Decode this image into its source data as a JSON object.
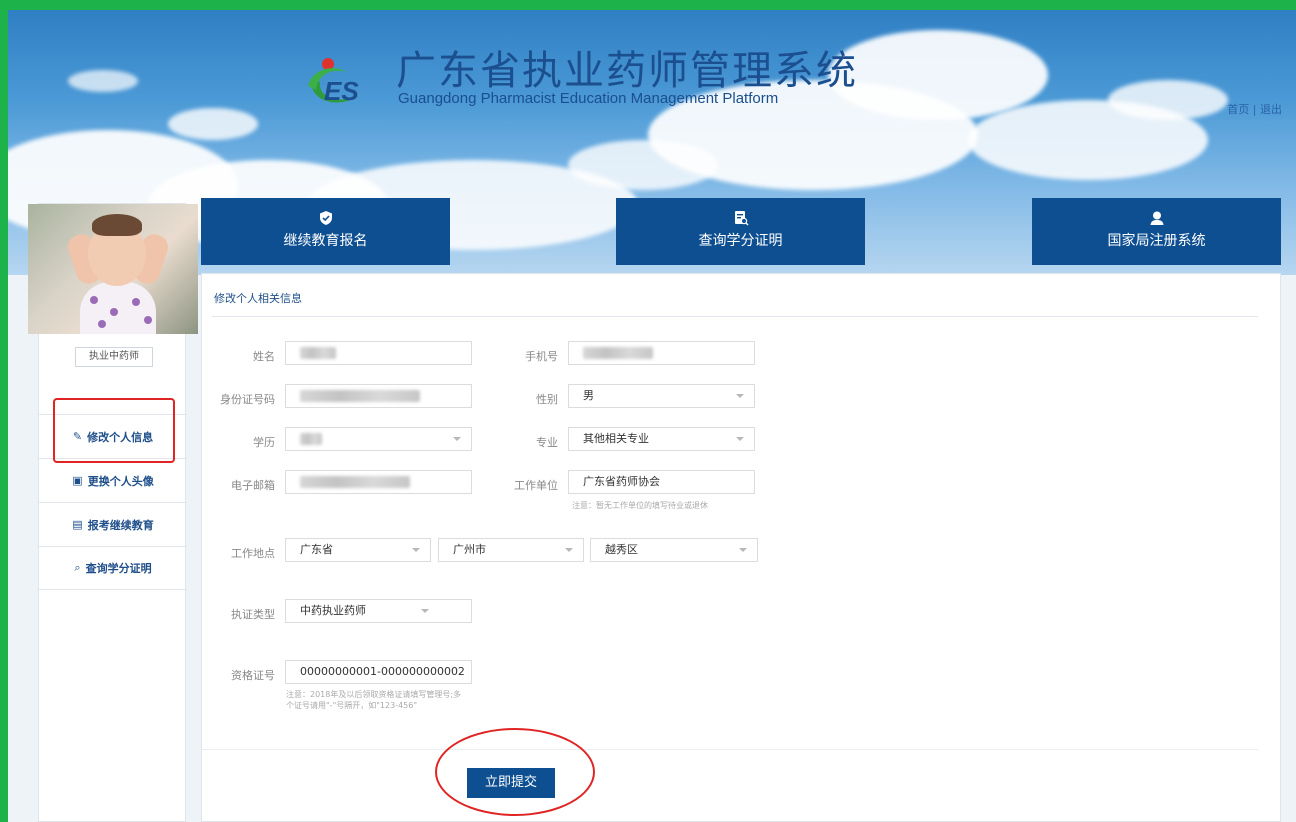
{
  "header": {
    "logo_text": "ES",
    "title": "广东省执业药师管理系统",
    "subtitle": "Guangdong Pharmacist Education Management Platform",
    "home_link": "首页",
    "separator": "|",
    "logout_link": "退出"
  },
  "nav": [
    {
      "label": "继续教育报名",
      "icon": "shield-icon"
    },
    {
      "label": "查询学分证明",
      "icon": "document-search-icon"
    },
    {
      "label": "国家局注册系统",
      "icon": "user-icon"
    }
  ],
  "sidebar": {
    "role": "执业中药师",
    "items": [
      {
        "label": "修改个人信息",
        "icon": "edit-icon"
      },
      {
        "label": "更换个人头像",
        "icon": "image-icon"
      },
      {
        "label": "报考继续教育",
        "icon": "clipboard-icon"
      },
      {
        "label": "查询学分证明",
        "icon": "search-doc-icon"
      }
    ]
  },
  "form": {
    "section_title": "修改个人相关信息",
    "labels": {
      "name": "姓名",
      "phone": "手机号",
      "id_number": "身份证号码",
      "gender": "性别",
      "education": "学历",
      "major": "专业",
      "email": "电子邮箱",
      "employer": "工作单位",
      "work_location": "工作地点",
      "license_type": "执证类型",
      "qualification_no": "资格证号"
    },
    "values": {
      "gender": "男",
      "major": "其他相关专业",
      "employer": "广东省药师协会",
      "province": "广东省",
      "city": "广州市",
      "district": "越秀区",
      "license_type": "中药执业药师",
      "qualification_no": "00000000001-000000000002"
    },
    "employer_note": "注意：暂无工作单位的填写待业或退休",
    "qualification_note": "注意：2018年及以后领取资格证请填写管理号;多个证号请用\"-\"号隔开，如\"123-456\"",
    "submit_label": "立即提交"
  },
  "colors": {
    "brand_blue": "#0e4f92",
    "highlight_red": "#e02424",
    "outer_green": "#1db34a"
  }
}
